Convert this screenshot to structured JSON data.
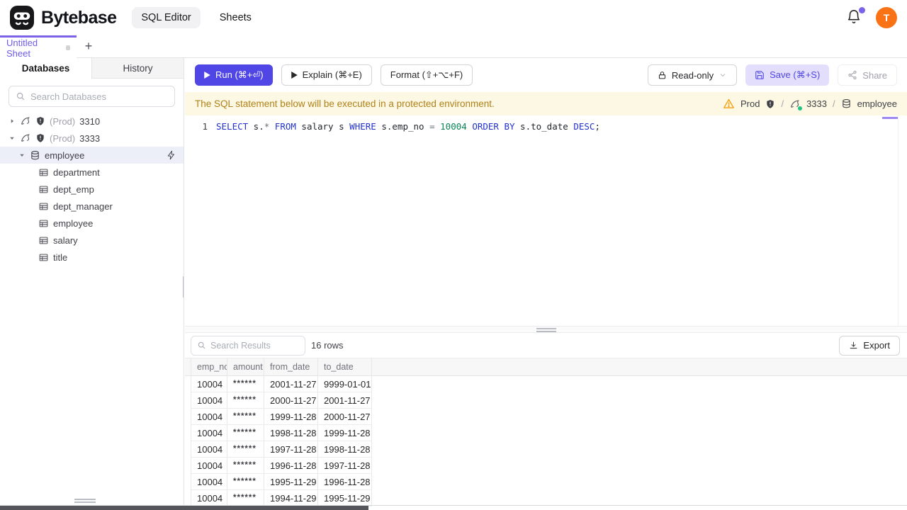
{
  "header": {
    "brand": "Bytebase",
    "nav": {
      "sql_editor": "SQL Editor",
      "sheets": "Sheets"
    },
    "avatar_text": "T"
  },
  "tab_bar": {
    "sheet_label": "Untitled Sheet",
    "add_label": "+"
  },
  "sidebar": {
    "tabs": {
      "databases": "Databases",
      "history": "History"
    },
    "search_placeholder": "Search Databases",
    "instances": [
      {
        "env": "(Prod)",
        "name": "3310",
        "expanded": false
      },
      {
        "env": "(Prod)",
        "name": "3333",
        "expanded": true
      }
    ],
    "database": "employee",
    "tables": [
      "department",
      "dept_emp",
      "dept_manager",
      "employee",
      "salary",
      "title"
    ]
  },
  "toolbar": {
    "run": "Run (⌘+⏎)",
    "explain": "Explain (⌘+E)",
    "format": "Format (⇧+⌥+F)",
    "readonly": "Read-only",
    "save": "Save (⌘+S)",
    "share": "Share"
  },
  "banner": {
    "message": "The SQL statement below will be executed in a protected environment.",
    "environment": "Prod",
    "sep": "/",
    "instance": "3333",
    "database": "employee"
  },
  "editor": {
    "line_number": "1",
    "sql": "SELECT s.* FROM salary s WHERE s.emp_no = 10004 ORDER BY s.to_date DESC;",
    "tokens": [
      {
        "text": "SELECT",
        "type": "keyword"
      },
      {
        "text": " s.",
        "type": "ident"
      },
      {
        "text": "*",
        "type": "operator"
      },
      {
        "text": " ",
        "type": "ident"
      },
      {
        "text": "FROM",
        "type": "keyword"
      },
      {
        "text": " salary s ",
        "type": "ident"
      },
      {
        "text": "WHERE",
        "type": "keyword"
      },
      {
        "text": " s.emp_no ",
        "type": "ident"
      },
      {
        "text": "=",
        "type": "operator"
      },
      {
        "text": " ",
        "type": "ident"
      },
      {
        "text": "10004",
        "type": "number"
      },
      {
        "text": " ",
        "type": "ident"
      },
      {
        "text": "ORDER BY",
        "type": "keyword"
      },
      {
        "text": " s.to_date ",
        "type": "ident"
      },
      {
        "text": "DESC",
        "type": "keyword"
      },
      {
        "text": ";",
        "type": "ident"
      }
    ]
  },
  "results": {
    "search_placeholder": "Search Results",
    "row_count": "16 rows",
    "export_label": "Export",
    "columns": [
      "emp_no",
      "amount",
      "from_date",
      "to_date"
    ],
    "rows": [
      [
        "10004",
        "******",
        "2001-11-27",
        "9999-01-01"
      ],
      [
        "10004",
        "******",
        "2000-11-27",
        "2001-11-27"
      ],
      [
        "10004",
        "******",
        "1999-11-28",
        "2000-11-27"
      ],
      [
        "10004",
        "******",
        "1998-11-28",
        "1999-11-28"
      ],
      [
        "10004",
        "******",
        "1997-11-28",
        "1998-11-28"
      ],
      [
        "10004",
        "******",
        "1996-11-28",
        "1997-11-28"
      ],
      [
        "10004",
        "******",
        "1995-11-29",
        "1996-11-28"
      ],
      [
        "10004",
        "******",
        "1994-11-29",
        "1995-11-29"
      ]
    ]
  },
  "colors": {
    "accent": "#4f46e5",
    "save_bg": "#e2defb",
    "tab_accent": "#7c62ea",
    "warning_bg": "#fdf8e3",
    "warning_text": "#b08018",
    "sql_keyword": "#2231cc",
    "sql_number": "#098658",
    "sql_operator": "#687078",
    "status_green": "#23c483",
    "avatar_bg": "#f97316",
    "selected_tree_bg": "#eceef8"
  }
}
